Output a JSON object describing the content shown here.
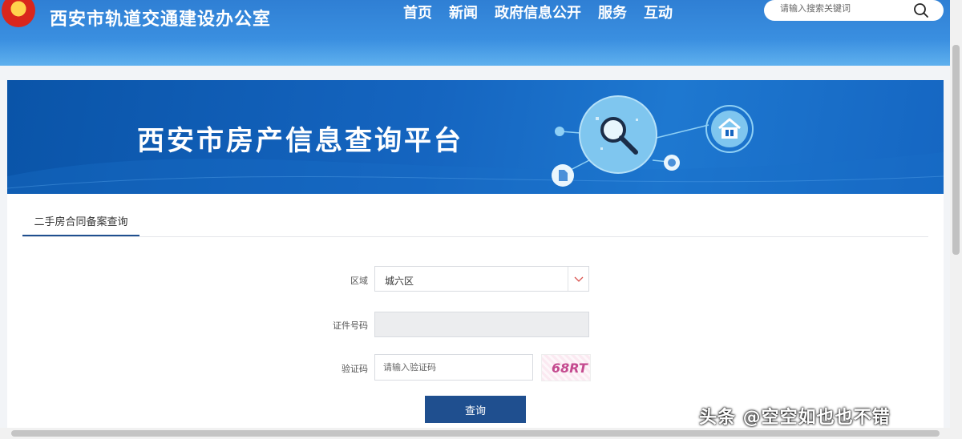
{
  "header": {
    "site_title": "西安市轨道交通建设办公室",
    "nav": [
      "首页",
      "新闻",
      "政府信息公开",
      "服务",
      "互动"
    ],
    "search_placeholder": "请输入搜索关键词"
  },
  "banner": {
    "title": "西安市房产信息查询平台"
  },
  "tabs": [
    {
      "label": "二手房合同备案查询",
      "active": true
    }
  ],
  "form": {
    "region_label": "区域",
    "region_value": "城六区",
    "id_label": "证件号码",
    "id_value": "",
    "captcha_label": "验证码",
    "captcha_placeholder": "请输入验证码",
    "captcha_text": "68RT",
    "submit_label": "查询"
  },
  "watermark": "头条 @空空如也也不错",
  "colors": {
    "header_blue": "#2f7fd4",
    "banner_blue": "#1565c0",
    "button_navy": "#1f4f8f"
  }
}
